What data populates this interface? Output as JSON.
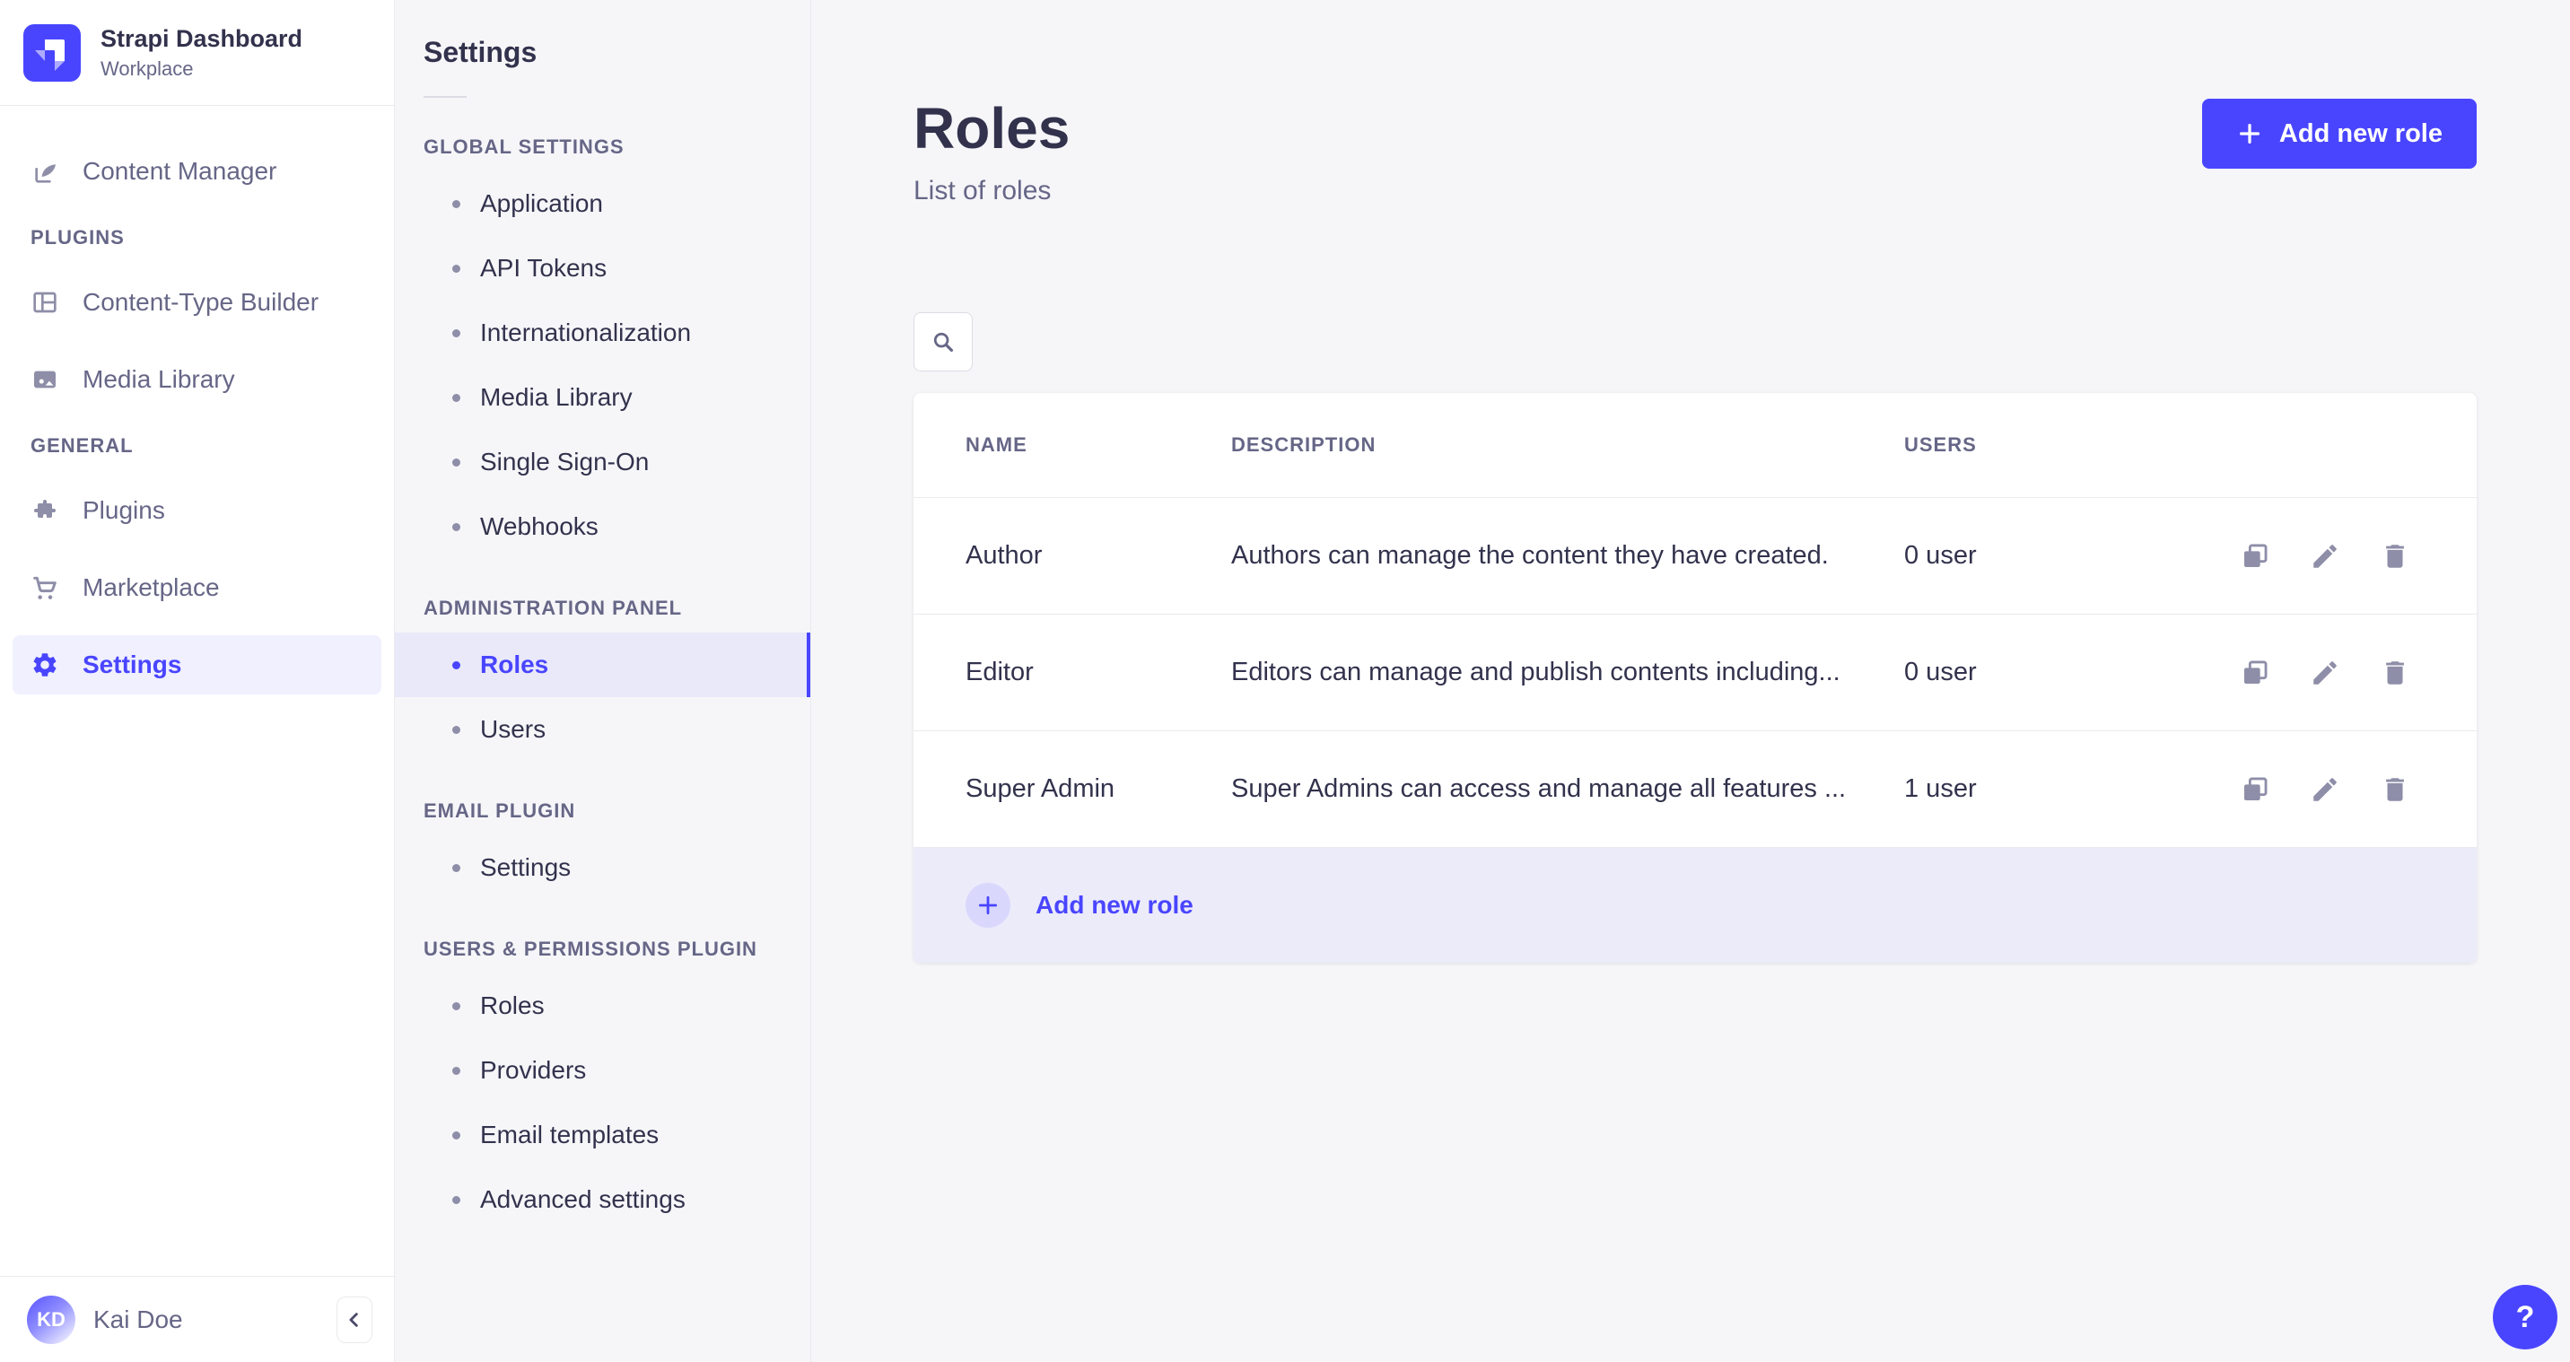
{
  "brand": {
    "name": "Strapi Dashboard",
    "workspace": "Workplace"
  },
  "colors": {
    "accent": "#4945ff",
    "accent_light_bg": "#f0f0ff",
    "subnav_active_bg": "#e9e9fa",
    "footer_bg": "#ecebfa",
    "text_dark": "#32324d",
    "text_muted": "#666687",
    "icon_gray": "#8e8ea9",
    "border": "#eaeaef"
  },
  "icons": {
    "logo": "strapi-logo",
    "content_manager": "feather-pen-icon",
    "content_type_builder": "layout-grid-icon",
    "media_library": "picture-icon",
    "plugins": "puzzle-icon",
    "marketplace": "shopping-cart-icon",
    "settings": "gear-icon",
    "search": "magnifier-icon",
    "add": "plus-icon",
    "duplicate": "copy-icon",
    "edit": "pencil-icon",
    "delete": "trash-icon",
    "collapse": "chevron-left-icon",
    "help": "question-mark-icon"
  },
  "main_nav": {
    "items": [
      {
        "label": "Content Manager"
      }
    ],
    "sections": [
      {
        "label": "PLUGINS",
        "items": [
          {
            "label": "Content-Type Builder"
          },
          {
            "label": "Media Library"
          }
        ]
      },
      {
        "label": "GENERAL",
        "items": [
          {
            "label": "Plugins"
          },
          {
            "label": "Marketplace"
          },
          {
            "label": "Settings"
          }
        ]
      }
    ],
    "user": {
      "initials": "KD",
      "name": "Kai Doe"
    }
  },
  "subnav": {
    "title": "Settings",
    "sections": [
      {
        "label": "GLOBAL SETTINGS",
        "items": [
          {
            "label": "Application"
          },
          {
            "label": "API Tokens"
          },
          {
            "label": "Internationalization"
          },
          {
            "label": "Media Library"
          },
          {
            "label": "Single Sign-On"
          },
          {
            "label": "Webhooks"
          }
        ]
      },
      {
        "label": "ADMINISTRATION PANEL",
        "items": [
          {
            "label": "Roles",
            "active": true
          },
          {
            "label": "Users"
          }
        ]
      },
      {
        "label": "EMAIL PLUGIN",
        "items": [
          {
            "label": "Settings"
          }
        ]
      },
      {
        "label": "USERS & PERMISSIONS PLUGIN",
        "items": [
          {
            "label": "Roles"
          },
          {
            "label": "Providers"
          },
          {
            "label": "Email templates"
          },
          {
            "label": "Advanced settings"
          }
        ]
      }
    ]
  },
  "header": {
    "title": "Roles",
    "subtitle": "List of roles",
    "add_button": "Add new role"
  },
  "table": {
    "columns": {
      "name": "Name",
      "description": "Description",
      "users": "Users"
    },
    "rows": [
      {
        "name": "Author",
        "description": "Authors can manage the content they have created.",
        "users": "0 user"
      },
      {
        "name": "Editor",
        "description": "Editors can manage and publish contents including...",
        "users": "0 user"
      },
      {
        "name": "Super Admin",
        "description": "Super Admins can access and manage all features ...",
        "users": "1 user"
      }
    ],
    "footer_action": "Add new role"
  },
  "help": {
    "label": "?"
  }
}
